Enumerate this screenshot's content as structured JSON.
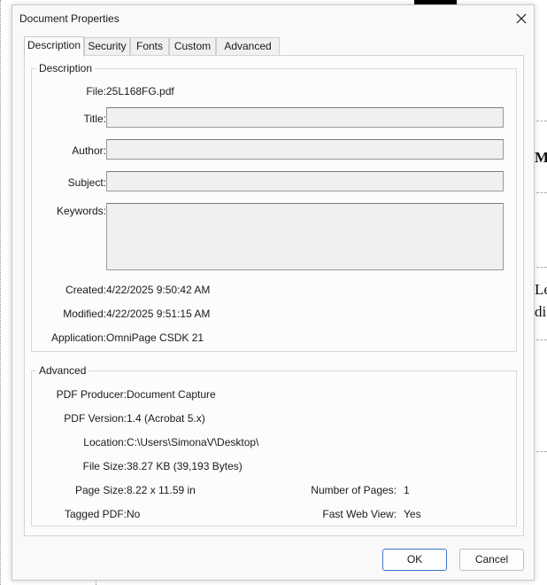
{
  "background": {
    "text_lines": [
      "M",
      "Le",
      "dia"
    ]
  },
  "dialog": {
    "title": "Document Properties",
    "tabs": [
      {
        "label": "Description",
        "active": true
      },
      {
        "label": "Security",
        "active": false
      },
      {
        "label": "Fonts",
        "active": false
      },
      {
        "label": "Custom",
        "active": false
      },
      {
        "label": "Advanced",
        "active": false
      }
    ],
    "description_group": {
      "legend": "Description",
      "file_label": "File:",
      "file_value": "25L168FG.pdf",
      "title_label": "Title:",
      "title_value": "",
      "author_label": "Author:",
      "author_value": "",
      "subject_label": "Subject:",
      "subject_value": "",
      "keywords_label": "Keywords:",
      "keywords_value": "",
      "created_label": "Created:",
      "created_value": "4/22/2025 9:50:42 AM",
      "modified_label": "Modified:",
      "modified_value": "4/22/2025 9:51:15 AM",
      "application_label": "Application:",
      "application_value": "OmniPage CSDK 21"
    },
    "advanced_group": {
      "legend": "Advanced",
      "producer_label": "PDF Producer:",
      "producer_value": "Document Capture",
      "version_label": "PDF Version:",
      "version_value": "1.4 (Acrobat 5.x)",
      "location_label": "Location:",
      "location_value": "C:\\Users\\SimonaV\\Desktop\\",
      "filesize_label": "File Size:",
      "filesize_value": "38.27 KB (39,193 Bytes)",
      "pagesize_label": "Page Size:",
      "pagesize_value": "8.22 x 11.59 in",
      "numpages_label": "Number of Pages:",
      "numpages_value": "1",
      "tagged_label": "Tagged PDF:",
      "tagged_value": "No",
      "fastweb_label": "Fast Web View:",
      "fastweb_value": "Yes"
    },
    "buttons": {
      "ok": "OK",
      "cancel": "Cancel"
    }
  },
  "colors": {
    "dialog_bg": "#f9f9f9",
    "field_bg": "#f0f0f0",
    "primary_border": "#3a74c9"
  }
}
